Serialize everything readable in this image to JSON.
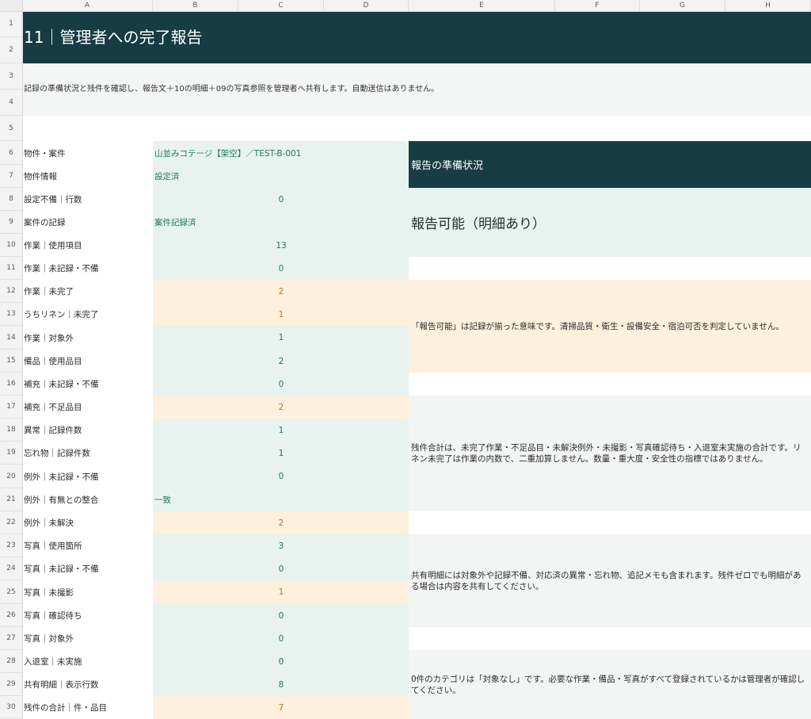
{
  "columns": [
    "A",
    "B",
    "C",
    "D",
    "E",
    "F",
    "G",
    "H"
  ],
  "rows": [
    "1",
    "2",
    "3",
    "4",
    "5",
    "6",
    "7",
    "8",
    "9",
    "10",
    "11",
    "12",
    "13",
    "14",
    "15",
    "16",
    "17",
    "18",
    "19",
    "20",
    "21",
    "22",
    "23",
    "24",
    "25",
    "26",
    "27",
    "28",
    "29",
    "30"
  ],
  "title": "11｜管理者への完了報告",
  "description": "記録の準備状況と残件を確認し、報告文＋10の明細＋09の写真参照を管理者へ共有します。自動送信はありません。",
  "items": [
    {
      "label": "物件・案件",
      "value": "山並みコテージ【架空】／TEST-B-001",
      "tone": "green",
      "kind": "txt"
    },
    {
      "label": "物件情報",
      "value": "設定済",
      "tone": "green",
      "kind": "txt"
    },
    {
      "label": "設定不備｜行数",
      "value": "0",
      "tone": "green",
      "kind": "num"
    },
    {
      "label": "案件の記録",
      "value": "案件記録済",
      "tone": "green",
      "kind": "txt"
    },
    {
      "label": "作業｜使用項目",
      "value": "13",
      "tone": "green",
      "kind": "num"
    },
    {
      "label": "作業｜未記録・不備",
      "value": "0",
      "tone": "green",
      "kind": "num"
    },
    {
      "label": "作業｜未完了",
      "value": "2",
      "tone": "orange",
      "kind": "num"
    },
    {
      "label": "うちリネン｜未完了",
      "value": "1",
      "tone": "orange",
      "kind": "num"
    },
    {
      "label": "作業｜対象外",
      "value": "1",
      "tone": "green",
      "kind": "num"
    },
    {
      "label": "備品｜使用品目",
      "value": "2",
      "tone": "green",
      "kind": "num"
    },
    {
      "label": "補充｜未記録・不備",
      "value": "0",
      "tone": "green",
      "kind": "num"
    },
    {
      "label": "補充｜不足品目",
      "value": "2",
      "tone": "orange",
      "kind": "num"
    },
    {
      "label": "異常｜記録件数",
      "value": "1",
      "tone": "green",
      "kind": "num"
    },
    {
      "label": "忘れ物｜記録件数",
      "value": "1",
      "tone": "green",
      "kind": "num"
    },
    {
      "label": "例外｜未記録・不備",
      "value": "0",
      "tone": "green",
      "kind": "num"
    },
    {
      "label": "例外｜有無との整合",
      "value": "一致",
      "tone": "green",
      "kind": "txt"
    },
    {
      "label": "例外｜未解決",
      "value": "2",
      "tone": "orange",
      "kind": "num"
    },
    {
      "label": "写真｜使用箇所",
      "value": "3",
      "tone": "green",
      "kind": "num"
    },
    {
      "label": "写真｜未記録・不備",
      "value": "0",
      "tone": "green",
      "kind": "num"
    },
    {
      "label": "写真｜未撮影",
      "value": "1",
      "tone": "orange",
      "kind": "num"
    },
    {
      "label": "写真｜確認待ち",
      "value": "0",
      "tone": "green",
      "kind": "num"
    },
    {
      "label": "写真｜対象外",
      "value": "0",
      "tone": "green",
      "kind": "num"
    },
    {
      "label": "入退室｜未実施",
      "value": "0",
      "tone": "green",
      "kind": "num"
    },
    {
      "label": "共有明細｜表示行数",
      "value": "8",
      "tone": "green",
      "kind": "num"
    },
    {
      "label": "残件の合計｜件・品目",
      "value": "7",
      "tone": "orange",
      "kind": "num"
    }
  ],
  "report_panel": {
    "heading": "報告の準備状況",
    "status": "報告可能（明細あり）",
    "notes": [
      "「報告可能」は記録が揃った意味です。清掃品質・衛生・設備安全・宿泊可否を判定していません。",
      "残件合計は、未完了作業・不足品目・未解決例外・未撮影・写真確認待ち・入退室未実施の合計です。リネン未完了は作業の内数で、二重加算しません。数量・重大度・安全性の指標ではありません。",
      "共有明細には対象外や記録不備、対応済の異常・忘れ物、追記メモも含まれます。残件ゼロでも明細がある場合は内容を共有してください。",
      "0件のカテゴリは「対象なし」です。必要な作業・備品・写真がすべて登録されているかは管理者が確認してください。"
    ]
  },
  "colors": {
    "header_dark": "#173c44",
    "ok_fill": "#e8f3ef",
    "ok_text": "#1f7a5c",
    "warn_fill": "#fdf0dc",
    "warn_text": "#c0712a"
  }
}
